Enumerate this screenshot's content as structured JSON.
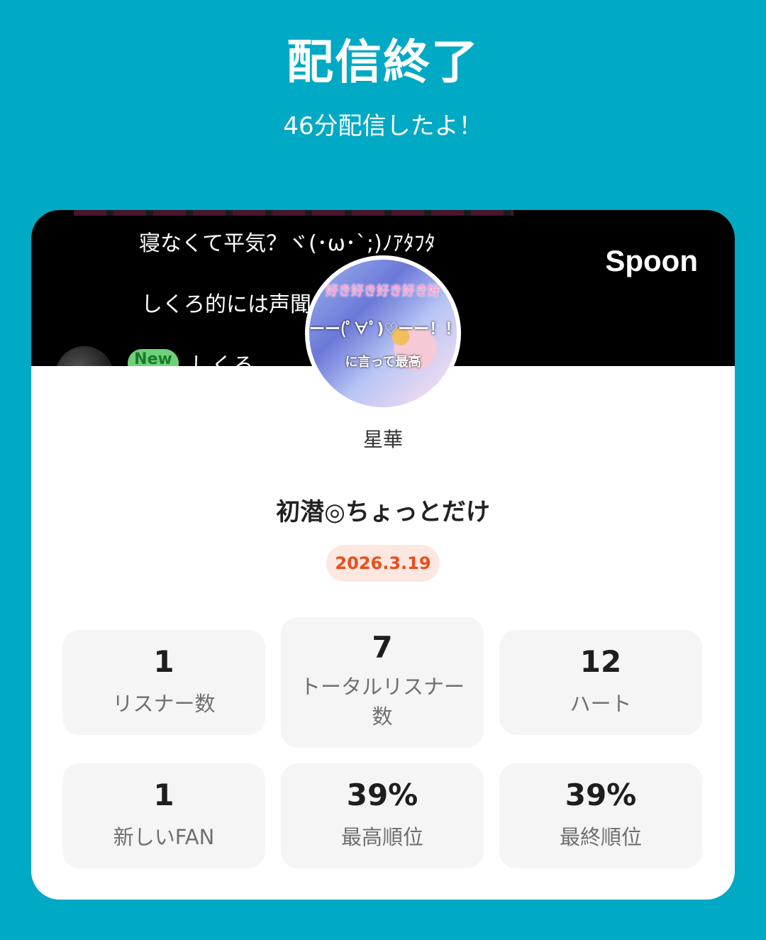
{
  "header": {
    "title": "配信終了",
    "subtitle": "46分配信したよ！"
  },
  "banner": {
    "chat_line_1": "寝なくて平気？ヾ(･ω･`;)ﾉｱﾀﾌﾀ",
    "chat_line_2": "しくろ的には声聞い",
    "new_badge": "New",
    "chat_name": "しくろ",
    "logo": "Spoon"
  },
  "avatar": {
    "overlay_1": "好き好き好き好き好",
    "overlay_2": "ーー(ﾟ∀ﾟ)♡ーー！！",
    "overlay_3": "に言って最高"
  },
  "host": {
    "name": "星華"
  },
  "stream": {
    "title": "初潜◎ちょっとだけ",
    "date": "2026.3.19"
  },
  "stats": {
    "listeners": {
      "value": "1",
      "label": "リスナー数"
    },
    "total_listeners": {
      "value": "7",
      "label": "トータルリスナー数"
    },
    "hearts": {
      "value": "12",
      "label": "ハート"
    },
    "new_fans": {
      "value": "1",
      "label": "新しいFAN"
    },
    "best_rank": {
      "value": "39%",
      "label": "最高順位"
    },
    "final_rank": {
      "value": "39%",
      "label": "最終順位"
    }
  },
  "colors": {
    "background": "#00a9c4",
    "date_text": "#ea4e1b",
    "date_pill": "#fde7e1",
    "new_badge": "#6fd07a"
  }
}
